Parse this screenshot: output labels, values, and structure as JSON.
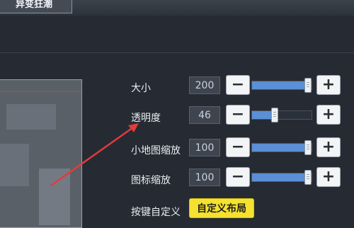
{
  "top_button": {
    "label": "异变狂潮"
  },
  "settings": {
    "rows": [
      {
        "label": "大小",
        "value": "200",
        "fill": 1.0
      },
      {
        "label": "透明度",
        "value": "46",
        "fill": 0.36
      },
      {
        "label": "小地图缩放",
        "value": "100",
        "fill": 1.0
      },
      {
        "label": "图标缩放",
        "value": "100",
        "fill": 1.0
      }
    ],
    "keymap": {
      "label": "按键自定义",
      "button": "自定义布局"
    }
  },
  "controls": {
    "minus": "−",
    "plus": "+"
  },
  "colors": {
    "accent": "#5b8fd6",
    "highlight": "#f5e12f",
    "annotation": "#e23b3b"
  }
}
